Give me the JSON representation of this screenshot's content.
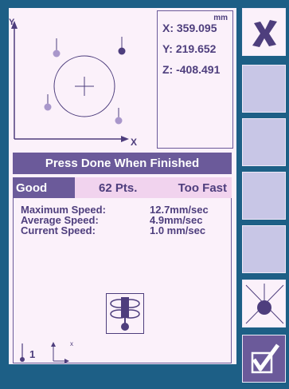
{
  "plot": {
    "y_axis_label": "Y",
    "x_axis_label": "X"
  },
  "coords": {
    "unit": "mm",
    "x": "X:  359.095",
    "y": "Y:  219.652",
    "z": "Z:  -408.491"
  },
  "status": {
    "title": "Press Done When Finished",
    "rating": "Good",
    "points": "62 Pts.",
    "speed_feedback": "Too Fast"
  },
  "stats": [
    {
      "label": "Maximum Speed:",
      "value": "12.7mm/sec"
    },
    {
      "label": "Average Speed:",
      "value": "4.9mm/sec"
    },
    {
      "label": "Current Speed:",
      "value": "1.0 mm/sec"
    }
  ],
  "footer": {
    "number": "1",
    "axis_label": "x"
  },
  "side_buttons": [
    "cancel-icon",
    "blank",
    "blank",
    "blank",
    "blank",
    "probe-point-icon",
    "done-check-icon"
  ],
  "colors": {
    "background": "#1d5f86",
    "panel": "#fbf1fa",
    "accent": "#6b5a9a",
    "text": "#4e3e7d",
    "button": "#c8c6e6"
  }
}
